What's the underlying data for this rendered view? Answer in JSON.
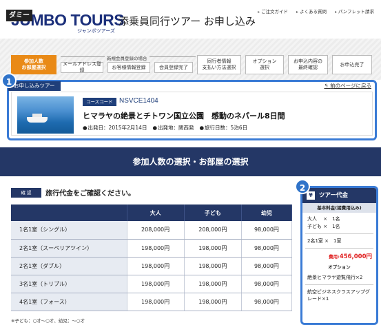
{
  "header": {
    "dummy_label": "ダミー",
    "logo_text": "JUMBO TOURS",
    "logo_sub": "ジャンボツアーズ",
    "site_title": "添乗員同行ツアー お申し込み",
    "top_links": [
      "ご注文ガイド",
      "よくある質問",
      "パンフレット請求"
    ]
  },
  "steps": {
    "new_member_label": "新規会員登録の場合",
    "items": [
      {
        "label": "参加人数\nお部屋選択",
        "active": true
      },
      {
        "label": "メールアドレス登録",
        "active": false
      },
      {
        "label": "お客様情報登録",
        "active": false
      },
      {
        "label": "会員登録完了",
        "active": false
      },
      {
        "label": "同行者情報\n支払い方法選択",
        "active": false
      },
      {
        "label": "オプション\n選択",
        "active": false
      },
      {
        "label": "お申込内容の\n最終確認",
        "active": false
      },
      {
        "label": "お申込完了",
        "active": false
      }
    ]
  },
  "tour": {
    "badge": "1",
    "tab_label": "お申し込みツアー",
    "back_link": "前のページに戻る",
    "course_label": "コースコード",
    "course_code": "NSVCE1404",
    "title": "ヒマラヤの絶景とチトワン国立公園　感動のネパール8日間",
    "departure_date": "出発日：2015年2月14日",
    "departure_place": "出発地：関西発",
    "duration": "旅行日数：5泊6日"
  },
  "section_title": "参加人数の選択・お部屋の選択",
  "confirm": {
    "tag": "確 認",
    "text": "旅行代金をご確認ください。"
  },
  "price_table": {
    "headers": [
      "",
      "大人",
      "子ども",
      "幼児"
    ],
    "rows": [
      {
        "room": "1名1室（シングル）",
        "adult": "208,000円",
        "child": "208,000円",
        "infant": "98,000円"
      },
      {
        "room": "2名1室（スーペリアツイン）",
        "adult": "198,000円",
        "child": "198,000円",
        "infant": "98,000円"
      },
      {
        "room": "2名1室（ダブル）",
        "adult": "198,000円",
        "child": "198,000円",
        "infant": "98,000円"
      },
      {
        "room": "3名1室（トリプル）",
        "adult": "198,000円",
        "child": "198,000円",
        "infant": "98,000円"
      },
      {
        "room": "4名1室（フォース）",
        "adult": "198,000円",
        "child": "198,000円",
        "infant": "98,000円"
      }
    ],
    "footnote": "※子ども：○才～○才、幼児：～○才"
  },
  "side_panel": {
    "badge": "2",
    "yen_icon": "¥",
    "title": "ツアー代金",
    "basic_label": "基本料金(諸費用込み)",
    "adult_line": "大人　 ×　1名",
    "child_line": "子ども ×　1名",
    "room_line": "2名1室 ×　1室",
    "total_label": "費用:",
    "total_value": "456,000円",
    "option_label": "オプション",
    "option1": "絶景ヒマラヤ遊覧飛行×2",
    "option2": "航空ビジネスクラスアップグレード×1"
  },
  "colors": {
    "navy": "#243766",
    "accent_orange": "#e98a17",
    "highlight_blue": "#3a7bd5",
    "total_red": "#e02020"
  }
}
